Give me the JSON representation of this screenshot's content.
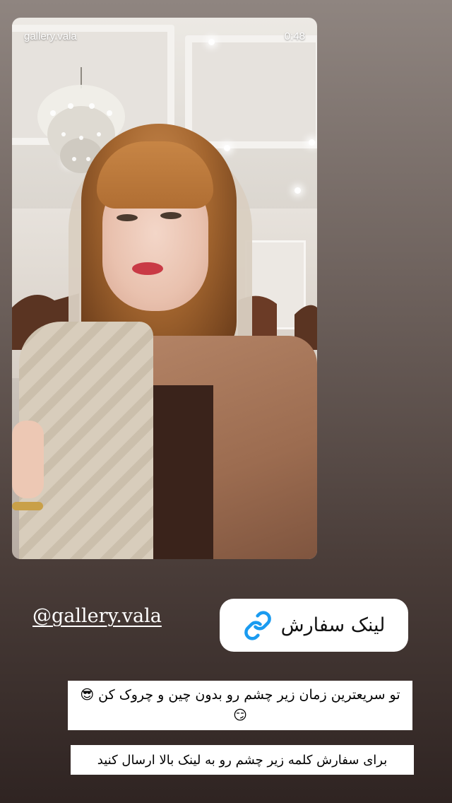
{
  "story": {
    "account": "gallery.vala",
    "time": "0:48"
  },
  "mention_sticker": {
    "text": "@gallery.vala"
  },
  "link_sticker": {
    "icon": "link-icon",
    "label": "لینک سفارش"
  },
  "captions": [
    {
      "text": "تو سریعترین زمان زیر چشم رو بدون چین و چروک کن 😎😏"
    },
    {
      "text": "برای سفارش کلمه زیر چشم رو به لینک بالا ارسال کنید"
    }
  ],
  "colors": {
    "link_icon": "#1a9bf0",
    "sticker_background": "#ffffff"
  }
}
